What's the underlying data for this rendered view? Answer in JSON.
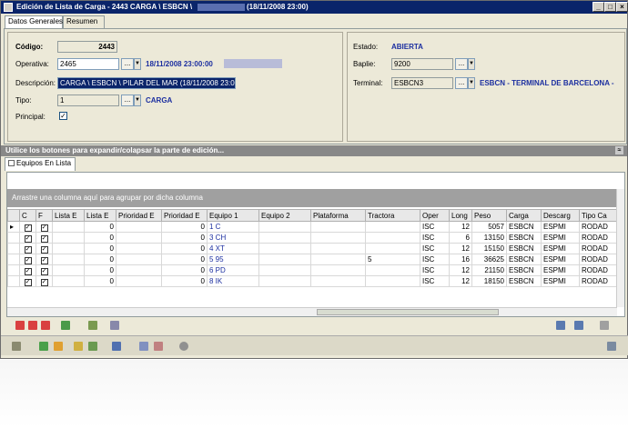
{
  "window": {
    "title": "Edición de Lista de Carga - 2443  CARGA \\ ESBCN \\",
    "title_date": "(18/11/2008 23:00)",
    "min": "_",
    "max": "□",
    "close": "×"
  },
  "tabs_top": [
    "Datos Generales",
    "Resumen"
  ],
  "form": {
    "codigo_label": "Código:",
    "codigo_value": "2443",
    "operativa_label": "Operativa:",
    "operativa_value": "2465",
    "operativa_info": "18/11/2008 23:00:00",
    "descripcion_label": "Descripción:",
    "descripcion_value": "CARGA \\ ESBCN \\ PILAR DEL MAR (18/11/2008 23:00)",
    "tipo_label": "Tipo:",
    "tipo_value": "1",
    "tipo_info": "CARGA",
    "principal_label": "Principal:",
    "estado_label": "Estado:",
    "estado_value": "ABIERTA",
    "baplie_label": "Baplie:",
    "baplie_value": "9200",
    "terminal_label": "Terminal:",
    "terminal_value": "ESBCN3",
    "terminal_info": "ESBCN - TERMINAL DE BARCELONA -",
    "dots": "..."
  },
  "hint": "Utilice los botones para expandir/colapsar la parte de edición...",
  "tabs_grid": [
    "Equipos En Lista"
  ],
  "grid": {
    "group_hint": "Arrastre una columna aquí para agrupar por dicha columna",
    "columns": [
      "C",
      "F",
      "Lista E",
      "Lista E",
      "Prioridad E",
      "Prioridad E",
      "Equipo 1",
      "Equipo 2",
      "Plataforma",
      "Tractora",
      "Oper",
      "Long",
      "Peso",
      "Carga",
      "Descarg",
      "Tipo Ca"
    ],
    "rows": [
      {
        "c1": "0",
        "c2": "0",
        "eq": "1      C",
        "trac": "",
        "oper": "ISC",
        "long": "12",
        "peso": "5057",
        "carga": "ESBCN",
        "desc": "ESPMI",
        "tipo": "RODAD"
      },
      {
        "c1": "0",
        "c2": "0",
        "eq": "3      CH",
        "trac": "",
        "oper": "ISC",
        "long": "6",
        "peso": "13150",
        "carga": "ESBCN",
        "desc": "ESPMI",
        "tipo": "RODAD"
      },
      {
        "c1": "0",
        "c2": "0",
        "eq": "4      XT",
        "trac": "",
        "oper": "ISC",
        "long": "12",
        "peso": "15150",
        "carga": "ESBCN",
        "desc": "ESPMI",
        "tipo": "RODAD"
      },
      {
        "c1": "0",
        "c2": "0",
        "eq": "5      95",
        "trac": "5",
        "oper": "ISC",
        "long": "16",
        "peso": "36625",
        "carga": "ESBCN",
        "desc": "ESPMI",
        "tipo": "RODAD"
      },
      {
        "c1": "0",
        "c2": "0",
        "eq": "6      PD",
        "trac": "",
        "oper": "ISC",
        "long": "12",
        "peso": "21150",
        "carga": "ESBCN",
        "desc": "ESPMI",
        "tipo": "RODAD"
      },
      {
        "c1": "0",
        "c2": "0",
        "eq": "8      IK",
        "trac": "",
        "oper": "ISC",
        "long": "12",
        "peso": "18150",
        "carga": "ESBCN",
        "desc": "ESPMI",
        "tipo": "RODAD"
      }
    ]
  },
  "colors": {
    "accent": "#0a246a",
    "info_blue": "#1c2fa0",
    "panel": "#ece9d8"
  },
  "icons": [
    "add-icon",
    "remove-icon",
    "up-icon",
    "export-icon",
    "filter-icon",
    "sort-icon",
    "ok-icon",
    "cancel-icon",
    "print-icon",
    "help-icon"
  ]
}
